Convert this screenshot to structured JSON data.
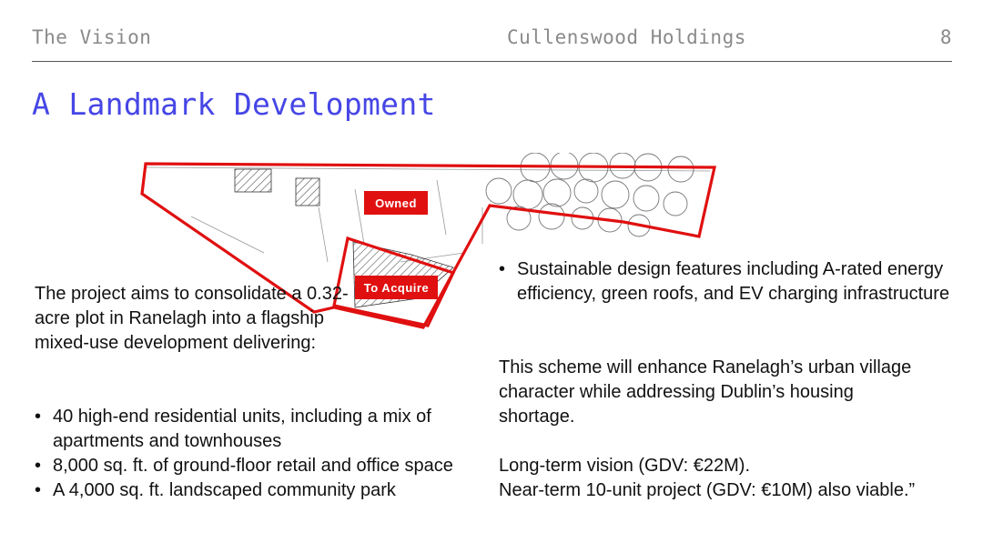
{
  "header": {
    "section": "The Vision",
    "company": "Cullenswood Holdings",
    "page_number": "8"
  },
  "title": "A Landmark Development",
  "site_plan": {
    "owned_label": "Owned",
    "acquire_label": "To Acquire",
    "boundary_color": "#e01010"
  },
  "intro_text": "The project aims to consolidate a 0.32-acre plot in Ranelagh into a flagship mixed-use development delivering:",
  "left_bullets": [
    "40 high-end residential units, including a mix of apartments and townhouses",
    "8,000 sq. ft. of ground-floor retail and office space",
    "A 4,000 sq. ft. landscaped community park"
  ],
  "right_bullets": [
    "Sustainable design features including A-rated energy efficiency, green roofs, and EV charging infrastructure"
  ],
  "paragraph_scheme": "This scheme will enhance Ranelagh’s urban village character while addressing Dublin’s housing shortage.",
  "vision_lines": [
    "Long-term vision (GDV: €22M).",
    "Near-term 10-unit project (GDV: €10M) also viable.”"
  ],
  "colors": {
    "accent": "#4646e6",
    "header_text": "#8a8a8a"
  }
}
